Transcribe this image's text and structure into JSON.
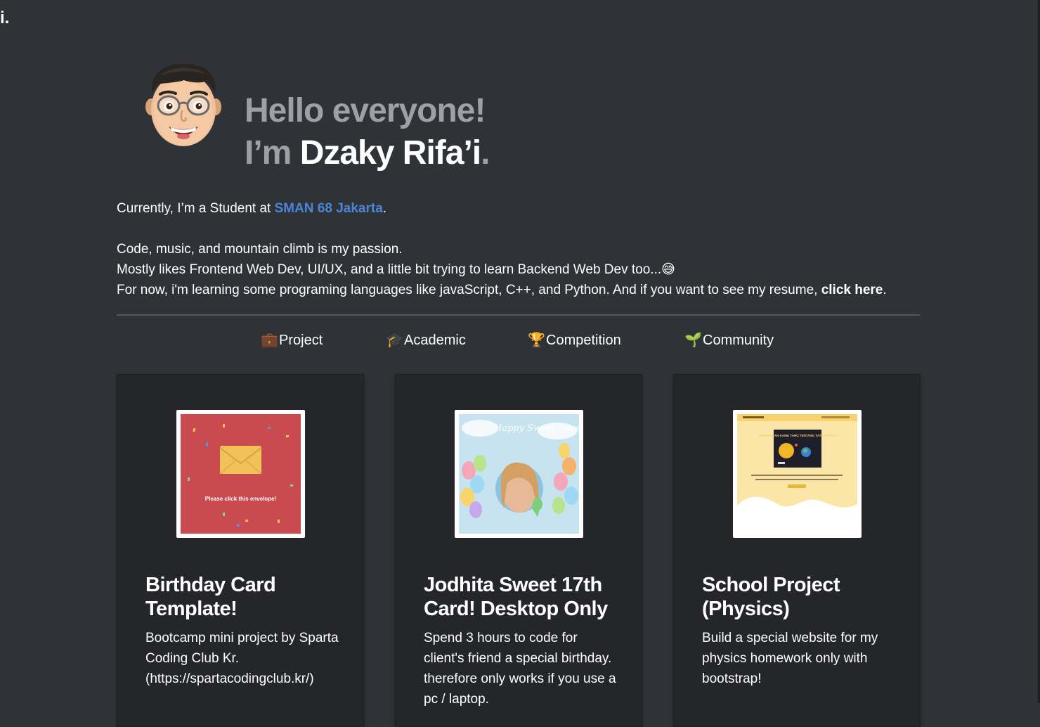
{
  "page": {
    "corner_mark": "i."
  },
  "hero": {
    "line1": "Hello everyone!",
    "line2_prefix": "I’m ",
    "name": "Dzaky Rifa’i",
    "line2_suffix": "."
  },
  "bio": {
    "student_prefix": "Currently, I’m a Student at ",
    "school": "SMAN 68 Jakarta",
    "student_suffix": ".",
    "passion": "Code, music, and mountain climb is my passion.",
    "likes": "Mostly likes Frontend Web Dev, UI/UX, and a little bit trying to learn Backend Web Dev too...",
    "likes_emoji": "😅",
    "learning": "For now, i'm learning some programing languages like javaScript, C++, and Python. And if you want to see my resume, ",
    "resume_link": "click here",
    "learning_suffix": "."
  },
  "tabs": [
    {
      "icon": "💼",
      "label": "Project"
    },
    {
      "icon": "🎓",
      "label": "Academic"
    },
    {
      "icon": "🏆",
      "label": "Competition"
    },
    {
      "icon": "🌱",
      "label": "Community"
    }
  ],
  "cards": [
    {
      "title": "Birthday Card Template!",
      "description": "Bootcamp mini project by Sparta Coding Club Kr. (https://spartacodingclub.kr/)",
      "thumb_text": "Please click this envelope!"
    },
    {
      "title": "Jodhita Sweet 17th Card! Desktop Only",
      "description": "Spend 3 hours to code for client's friend a special birthday. therefore only works if you use a pc / laptop.",
      "thumb_text": "Happy Sweet Seventeen Odhi!"
    },
    {
      "title": "School Project (Physics)",
      "description": "Build a special website for my physics homework only with bootstrap!",
      "thumb_text": "PERNAHKAH KAMU TAHU TENTANG TATA SURYA?"
    }
  ],
  "colors": {
    "background": "#2f3237",
    "card": "#24262a",
    "link": "#4b86d6",
    "muted": "#9da1a7"
  }
}
